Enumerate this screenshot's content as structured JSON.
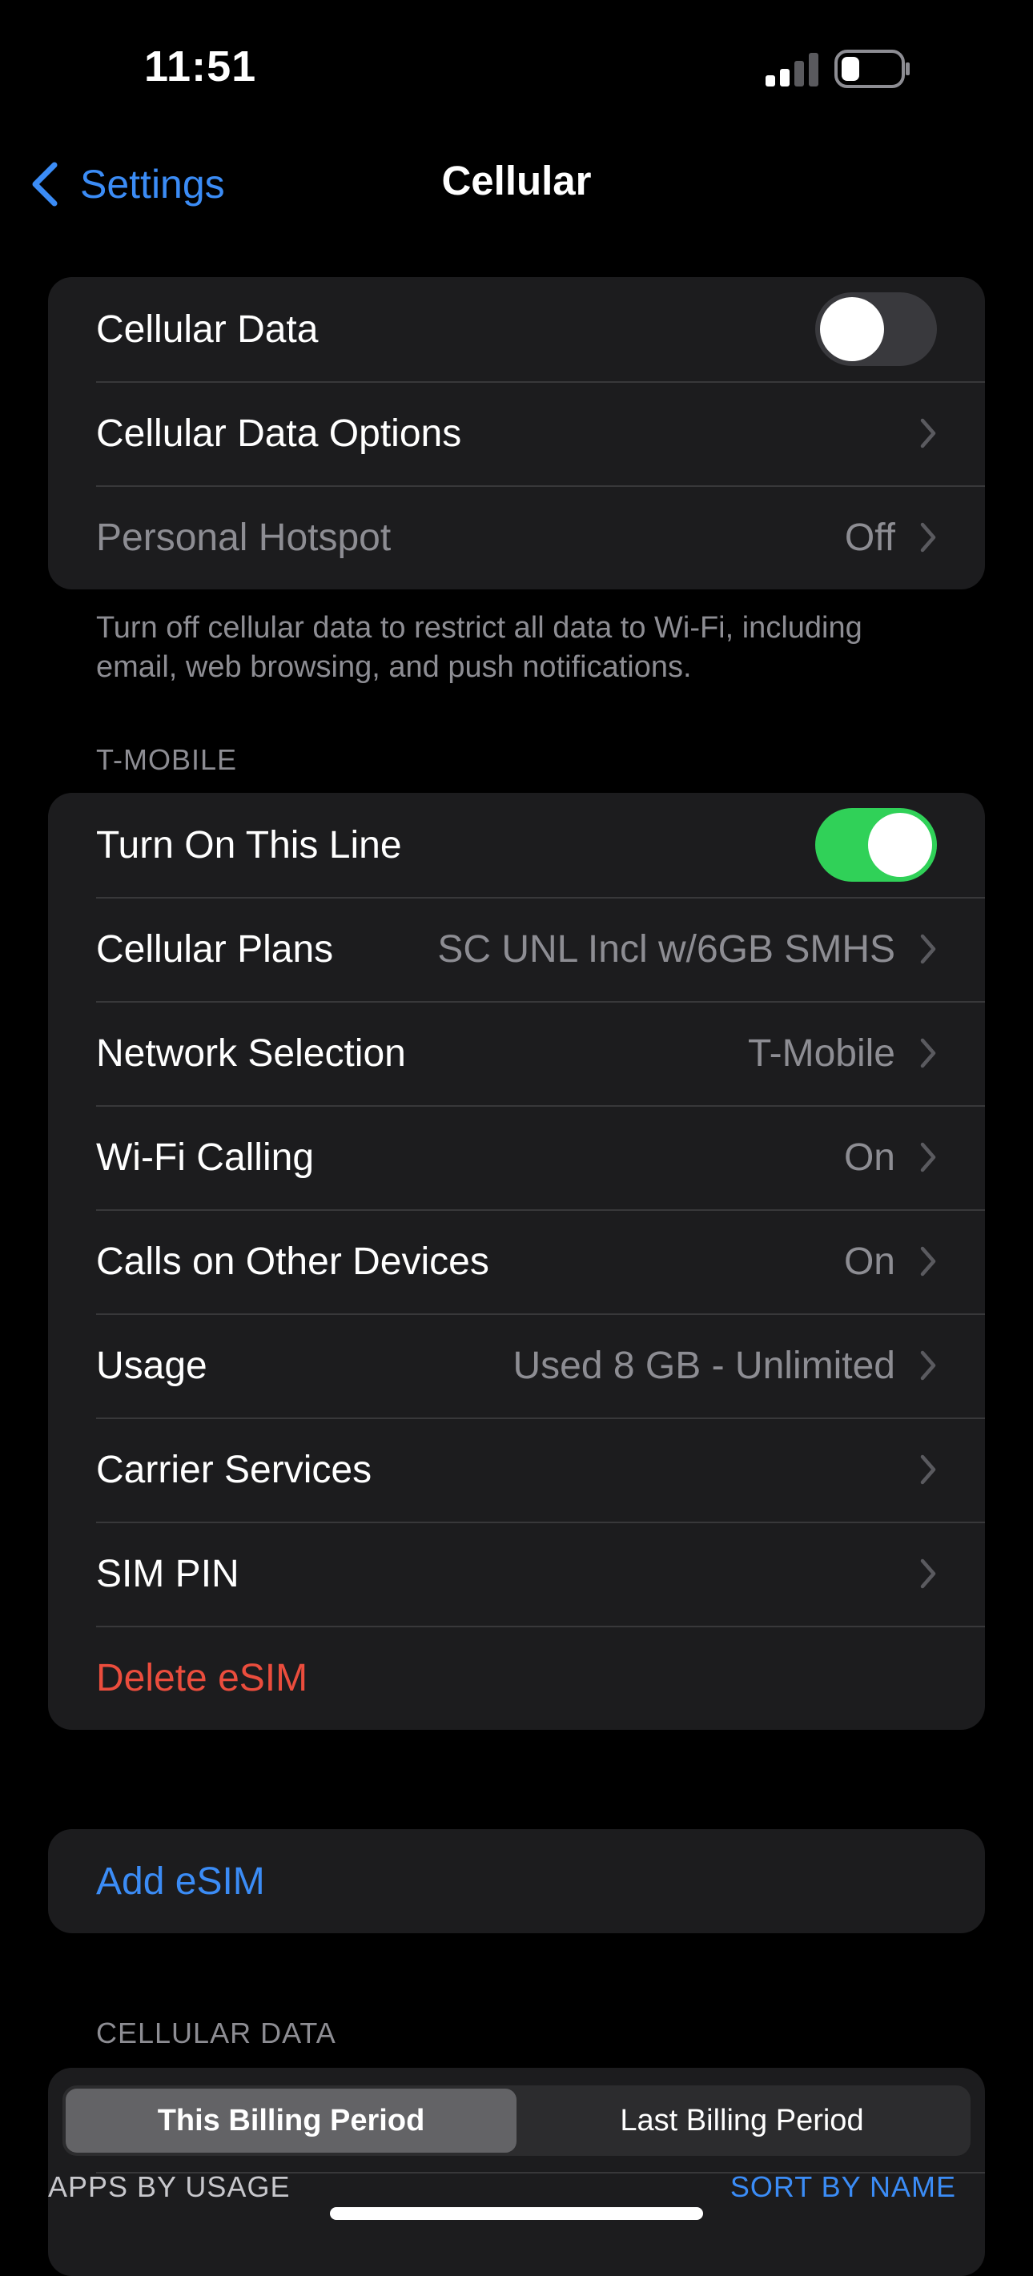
{
  "status_bar": {
    "time": "11:51",
    "signal_icon": "cellular-signal-icon",
    "battery_icon": "battery-low-icon"
  },
  "nav": {
    "back_label": "Settings",
    "title": "Cellular"
  },
  "group1": {
    "cellular_data_label": "Cellular Data",
    "cellular_data_on": false,
    "options_label": "Cellular Data Options",
    "hotspot_label": "Personal Hotspot",
    "hotspot_value": "Off"
  },
  "group1_footer": "Turn off cellular data to restrict all data to Wi-Fi, including email, web browsing, and push notifications.",
  "tmobile": {
    "header": "T-MOBILE",
    "line_label": "Turn On This Line",
    "line_on": true,
    "rows": [
      {
        "label": "Cellular Plans",
        "value": "SC UNL Incl w/6GB SMHS"
      },
      {
        "label": "Network Selection",
        "value": "T-Mobile"
      },
      {
        "label": "Wi-Fi Calling",
        "value": "On"
      },
      {
        "label": "Calls on Other Devices",
        "value": "On"
      },
      {
        "label": "Usage",
        "value": "Used 8 GB - Unlimited"
      },
      {
        "label": "Carrier Services",
        "value": ""
      },
      {
        "label": "SIM PIN",
        "value": ""
      }
    ],
    "delete_label": "Delete eSIM"
  },
  "add_esim_label": "Add eSIM",
  "cellular_data_section": {
    "header": "CELLULAR DATA",
    "segments": [
      "This Billing Period",
      "Last Billing Period"
    ],
    "selected_segment": 0,
    "apps_label": "APPS BY USAGE",
    "sort_label": "SORT BY NAME"
  },
  "colors": {
    "accent_blue": "#3b8cf6",
    "toggle_green": "#30d158",
    "destructive_red": "#eb4d3d",
    "cell_background": "#1c1c1e"
  }
}
